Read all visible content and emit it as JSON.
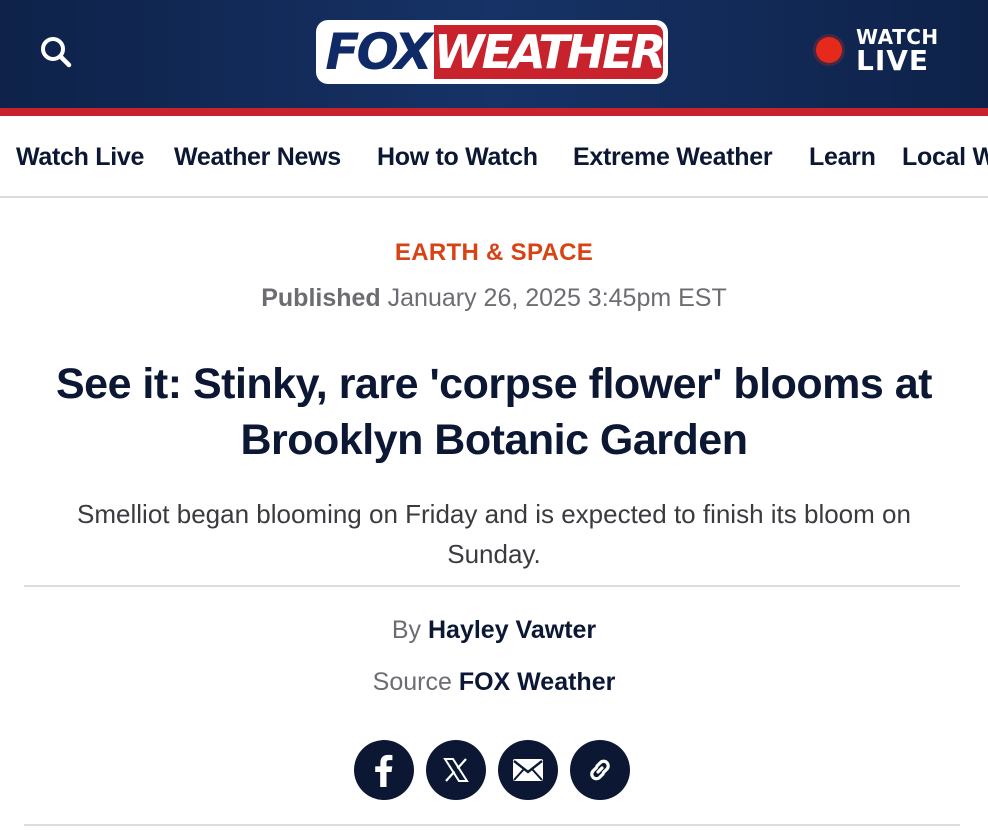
{
  "header": {
    "logo": {
      "fox": "FOX",
      "weather": "WEATHER"
    },
    "watch_live": {
      "line1": "WATCH",
      "line2": "LIVE"
    },
    "colors": {
      "header_bg": "#0e2249",
      "stripe": "#c8232c",
      "live_dot": "#e52a1c"
    },
    "icons": {
      "search": "search-icon"
    }
  },
  "nav": {
    "items": [
      "Watch Live",
      "Weather News",
      "How to Watch",
      "Extreme Weather",
      "Learn",
      "Local W"
    ]
  },
  "article": {
    "category": "EARTH & SPACE",
    "published_label": "Published",
    "published_date": "January 26, 2025 3:45pm EST",
    "headline": "See it: Stinky, rare 'corpse flower' blooms at Brooklyn Botanic Garden",
    "dek": "Smelliot began blooming on Friday and is expected to finish its bloom on Sunday.",
    "byline_label": "By",
    "author": "Hayley Vawter",
    "source_label": "Source",
    "source_name": "FOX Weather",
    "category_color": "#d84315",
    "text_color": "#0b1733"
  },
  "share": {
    "icons": [
      "facebook-icon",
      "x-icon",
      "email-icon",
      "link-icon"
    ]
  }
}
